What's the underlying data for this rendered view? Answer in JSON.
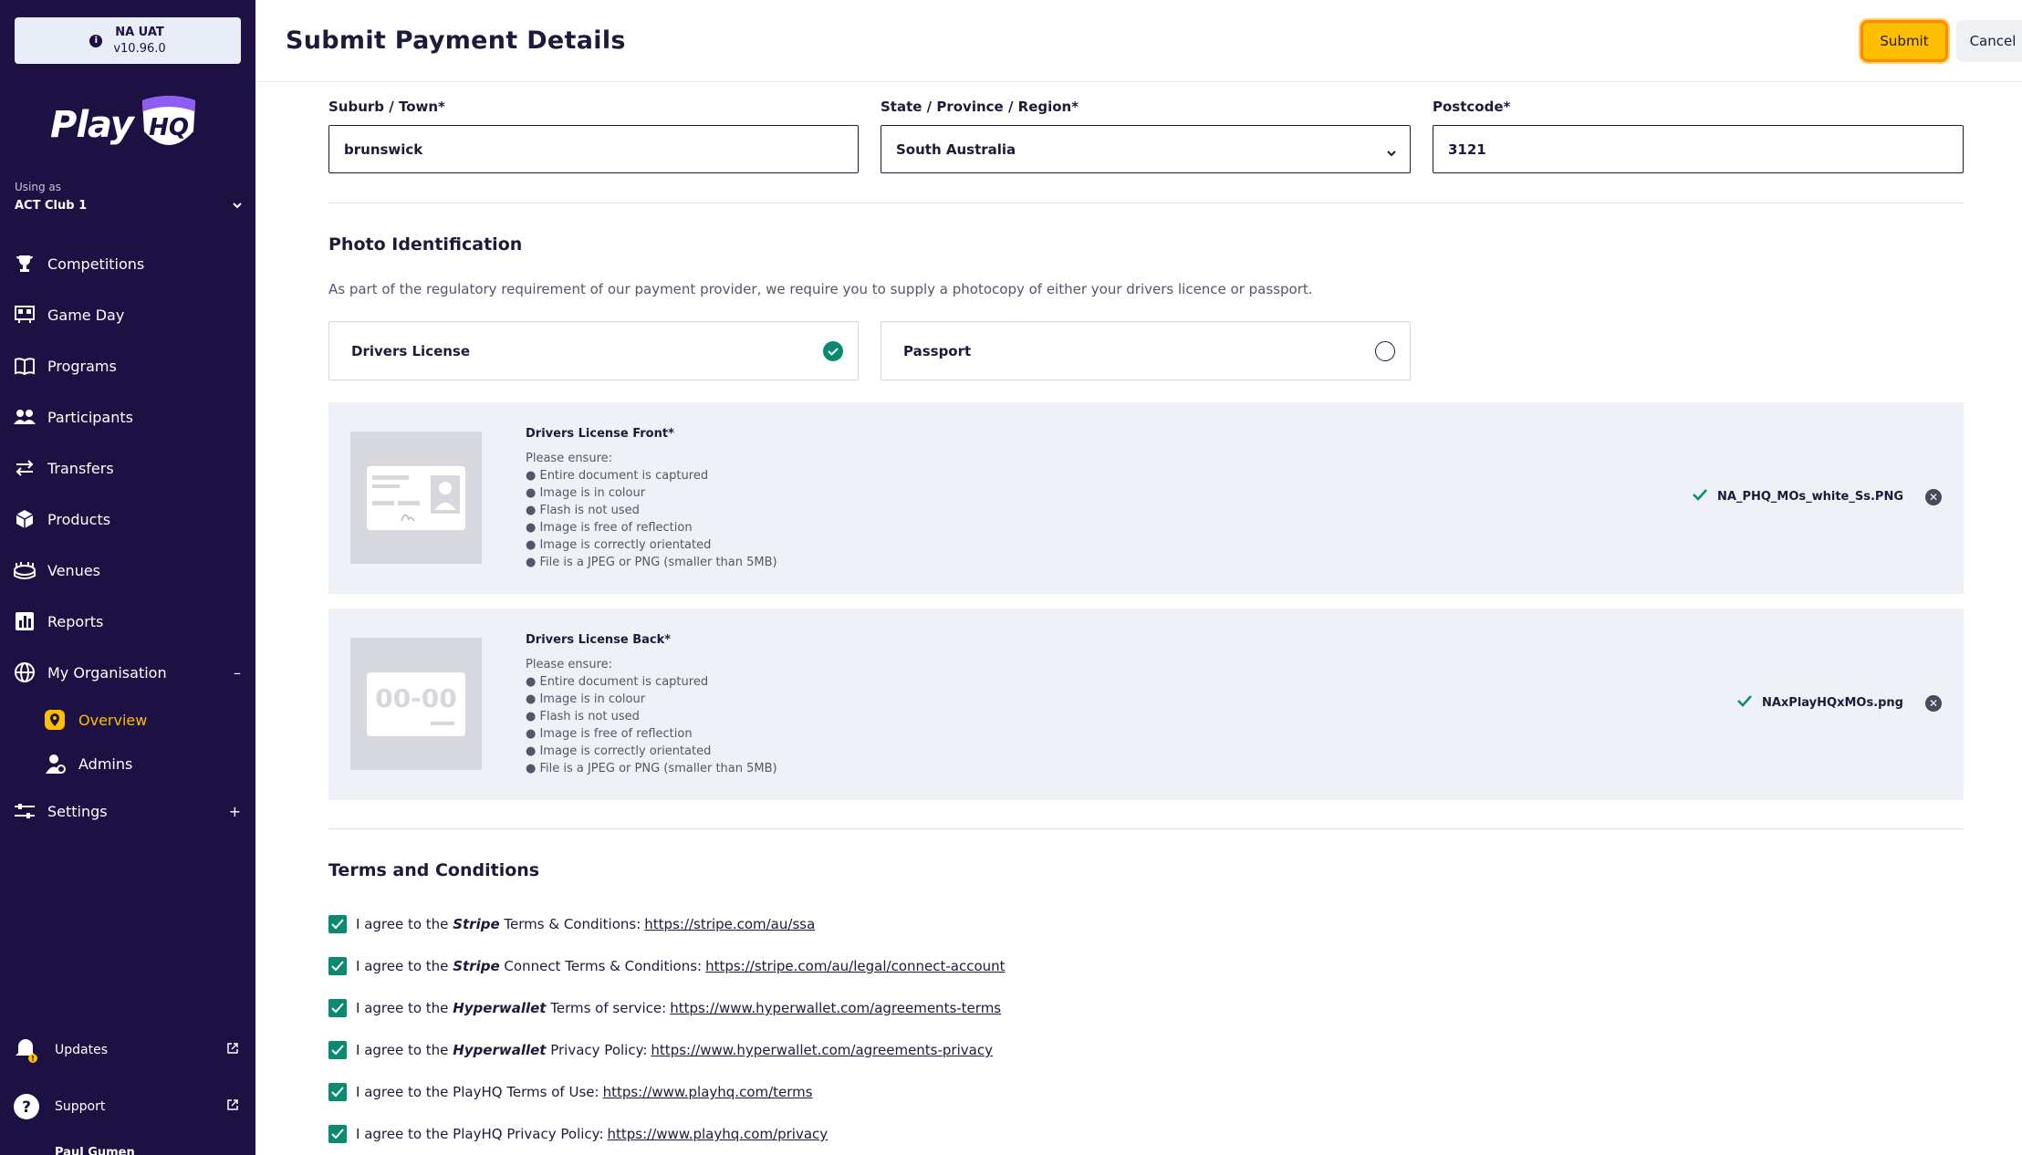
{
  "env": {
    "name": "NA UAT",
    "version": "v10.96.0",
    "icon": "info-icon"
  },
  "logo": {
    "text": "Play",
    "mark": "HQ"
  },
  "using_as": {
    "label": "Using as",
    "value": "ACT Club 1"
  },
  "nav": [
    {
      "label": "Competitions",
      "icon": "trophy-icon"
    },
    {
      "label": "Game Day",
      "icon": "scoreboard-icon"
    },
    {
      "label": "Programs",
      "icon": "book-icon"
    },
    {
      "label": "Participants",
      "icon": "people-icon"
    },
    {
      "label": "Transfers",
      "icon": "transfer-icon"
    },
    {
      "label": "Products",
      "icon": "box-icon"
    },
    {
      "label": "Venues",
      "icon": "stadium-icon"
    },
    {
      "label": "Reports",
      "icon": "report-icon"
    },
    {
      "label": "My Organisation",
      "icon": "globe-icon",
      "trail": "–"
    }
  ],
  "org_sub": [
    {
      "label": "Overview",
      "icon": "location-icon",
      "active": true
    },
    {
      "label": "Admins",
      "icon": "admin-icon",
      "active": false
    }
  ],
  "settings": {
    "label": "Settings",
    "icon": "sliders-icon",
    "trail": "+"
  },
  "bottom": [
    {
      "label": "Updates",
      "icon": "bell-icon"
    },
    {
      "label": "Support",
      "icon": "question-icon"
    }
  ],
  "user_peek": "Paul Gumen",
  "header": {
    "title": "Submit Payment Details",
    "submit": "Submit",
    "cancel": "Cancel"
  },
  "address": {
    "suburb_label": "Suburb / Town*",
    "suburb_value": "brunswick",
    "state_label": "State / Province / Region*",
    "state_value": "South Australia",
    "postcode_label": "Postcode*",
    "postcode_value": "3121"
  },
  "photo_id": {
    "title": "Photo Identification",
    "description": "As part of the regulatory requirement of our payment provider, we require you to supply a photocopy of either your drivers licence or passport.",
    "option_license": "Drivers License",
    "option_passport": "Passport",
    "selected": "Drivers License"
  },
  "uploads": [
    {
      "title": "Drivers License Front*",
      "ensure": "Please ensure:",
      "rules": [
        "● Entire document is captured",
        "● Image is in colour",
        "● Flash is not used",
        "● Image is free of reflection",
        "● Image is correctly orientated",
        "● File is a JPEG or PNG (smaller than 5MB)"
      ],
      "file": "NA_PHQ_MOs_white_Ss.PNG"
    },
    {
      "title": "Drivers License Back*",
      "ensure": "Please ensure:",
      "rules": [
        "● Entire document is captured",
        "● Image is in colour",
        "● Flash is not used",
        "● Image is free of reflection",
        "● Image is correctly orientated",
        "● File is a JPEG or PNG (smaller than 5MB)"
      ],
      "file": "NAxPlayHQxMOs.png",
      "thumb_text": "00-00"
    }
  ],
  "terms": {
    "title": "Terms and Conditions",
    "items": [
      {
        "pre": "I agree to the",
        "brand": "Stripe",
        "post": "Terms & Conditions:",
        "link": "https://stripe.com/au/ssa"
      },
      {
        "pre": "I agree to the",
        "brand": "Stripe",
        "post": "Connect Terms & Conditions:",
        "link": "https://stripe.com/au/legal/connect-account"
      },
      {
        "pre": "I agree to the",
        "brand": "Hyperwallet",
        "post": "Terms of service:",
        "link": "https://www.hyperwallet.com/agreements-terms"
      },
      {
        "pre": "I agree to the",
        "brand": "Hyperwallet",
        "post": "Privacy Policy:",
        "link": "https://www.hyperwallet.com/agreements-privacy"
      },
      {
        "pre": "I agree to the PlayHQ Terms of Use:",
        "brand": "",
        "post": "",
        "link": "https://www.playhq.com/terms"
      },
      {
        "pre": "I agree to the PlayHQ Privacy Policy:",
        "brand": "",
        "post": "",
        "link": "https://www.playhq.com/privacy"
      }
    ]
  },
  "colors": {
    "sidebar": "#1d1042",
    "accent": "#ffbe00",
    "check": "#0b8a6f"
  }
}
